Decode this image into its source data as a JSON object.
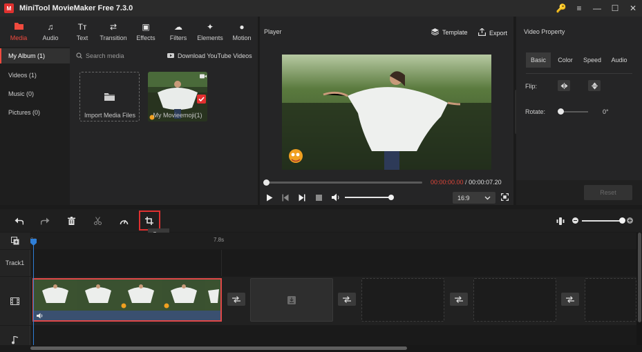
{
  "app": {
    "title": "MiniTool MovieMaker Free 7.3.0",
    "logo_letter": "M",
    "window_buttons": [
      "🔑",
      "≡",
      "—",
      "☐",
      "✕"
    ]
  },
  "media_tabs": [
    {
      "label": "Media",
      "icon": "folder-icon",
      "glyph": "▬"
    },
    {
      "label": "Audio",
      "icon": "music-note-icon",
      "glyph": "♫"
    },
    {
      "label": "Text",
      "icon": "text-icon",
      "glyph": "Tт"
    },
    {
      "label": "Transition",
      "icon": "transition-icon",
      "glyph": "⇄"
    },
    {
      "label": "Effects",
      "icon": "effects-icon",
      "glyph": "▣"
    },
    {
      "label": "Filters",
      "icon": "filters-icon",
      "glyph": "☁"
    },
    {
      "label": "Elements",
      "icon": "elements-icon",
      "glyph": "✦"
    },
    {
      "label": "Motion",
      "icon": "motion-icon",
      "glyph": "●"
    }
  ],
  "sidebar": [
    {
      "label": "My Album (1)",
      "active": true
    },
    {
      "label": "Videos (1)"
    },
    {
      "label": "Music (0)"
    },
    {
      "label": "Pictures (0)"
    }
  ],
  "search": {
    "placeholder": "Search media"
  },
  "download_link": "Download YouTube Videos",
  "media_items": [
    {
      "caption": "Import Media Files"
    },
    {
      "caption": "My Movieemoji(1)"
    }
  ],
  "player": {
    "label": "Player",
    "template_label": "Template",
    "export_label": "Export",
    "time_current": "00:00:00.00",
    "time_separator": " / ",
    "time_total": "00:00:07.20",
    "aspect_ratio": "16:9",
    "progress": 0,
    "volume": 1
  },
  "video_property": {
    "title": "Video Property",
    "tabs": [
      "Basic",
      "Color",
      "Speed",
      "Audio"
    ],
    "active_tab": "Basic",
    "flip_label": "Flip:",
    "rotate_label": "Rotate:",
    "rotate_value": "0°",
    "reset_label": "Reset"
  },
  "timeline": {
    "tooltip": "Crop",
    "ruler_start": "0s",
    "ruler_mark": "7.8s",
    "track_label": "Track1",
    "zoom": 1
  },
  "colors": {
    "accent": "#f04a3e",
    "highlight": "#e03030",
    "playhead": "#2f7fd8",
    "clip_audio": "#3a5070"
  }
}
